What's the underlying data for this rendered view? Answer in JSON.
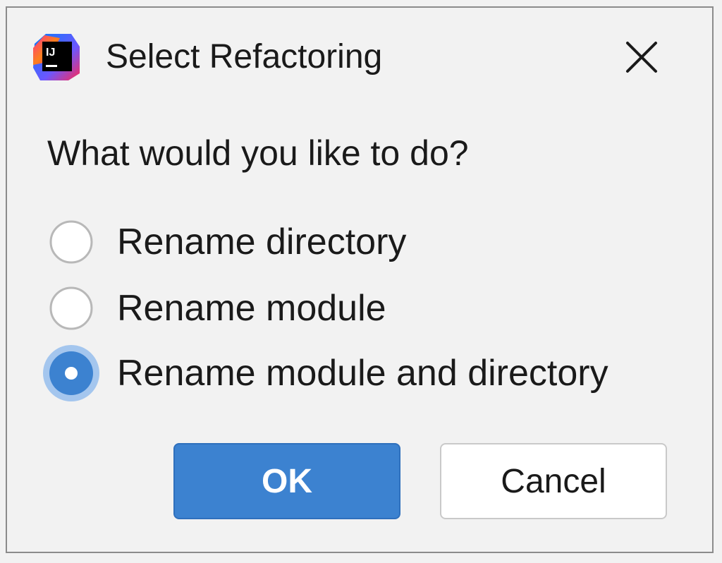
{
  "dialog": {
    "title": "Select Refactoring",
    "app_icon": "intellij-idea-icon",
    "app_icon_text": "IJ",
    "close_icon": "close-icon"
  },
  "prompt": "What would you like to do?",
  "options": [
    {
      "label": "Rename directory",
      "selected": false
    },
    {
      "label": "Rename module",
      "selected": false
    },
    {
      "label": "Rename module and directory",
      "selected": true
    }
  ],
  "buttons": {
    "ok_label": "OK",
    "cancel_label": "Cancel"
  },
  "colors": {
    "accent": "#3c82d0",
    "radio_border": "#b8b8b8",
    "radio_focus_ring": "#8ab7ec",
    "dialog_bg": "#f2f2f2"
  }
}
